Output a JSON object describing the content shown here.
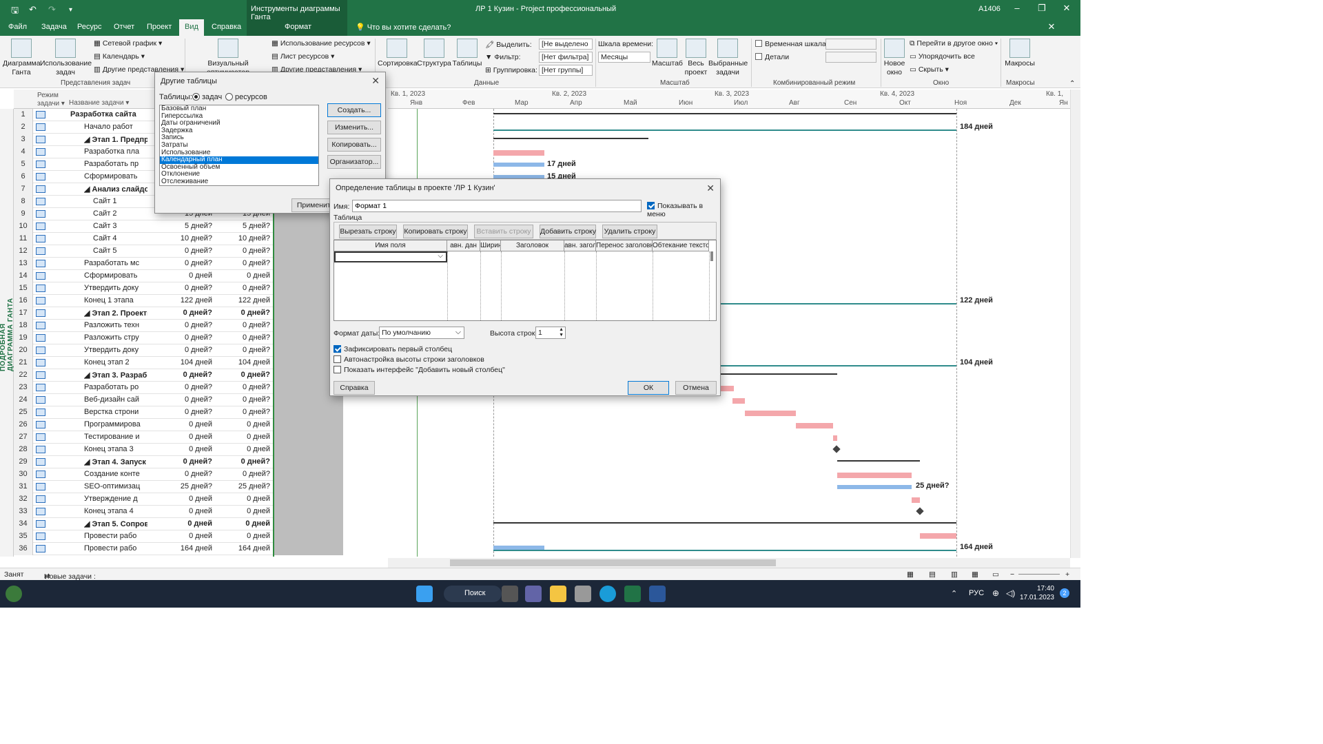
{
  "titlebar": {
    "context_group": "Инструменты диаграммы Ганта",
    "app_title": "ЛР 1 Кузин  -  Project профессиональный",
    "user": "A1406"
  },
  "tabs": [
    "Файл",
    "Задача",
    "Ресурс",
    "Отчет",
    "Проект",
    "Вид",
    "Справка"
  ],
  "active_tab": "Вид",
  "context_tab": "Формат",
  "tell_me": "Что вы хотите сделать?",
  "ribbon": {
    "gantt_chart": "Диаграмма Ганта",
    "task_usage": "Использование задач",
    "network_graph": "Сетевой график",
    "calendar": "Календарь",
    "other_views": "Другие представления",
    "team_planner": "Визуальный оптимизатор",
    "resource_usage": "Использование ресурсов",
    "resource_sheet": "Лист ресурсов",
    "other_views_2": "Другие представления",
    "task_views_group": "Представления задач",
    "sort": "Сортировка",
    "outline": "Структура",
    "tables": "Таблицы",
    "highlight_label": "Выделить:",
    "highlight_value": "[Не выделено",
    "filter_label": "Фильтр:",
    "filter_value": "[Нет фильтра]",
    "group_label": "Группировка:",
    "group_value": "[Нет группы]",
    "data_group": "Данные",
    "timescale_label": "Шкала времени:",
    "timescale_value": "Месяцы",
    "zoom": "Масштаб",
    "entire_project": "Весь проект",
    "selected_tasks": "Выбранные задачи",
    "zoom_group": "Масштаб",
    "timeline_chk": "Временная шкала",
    "details_chk": "Детали",
    "split_group": "Комбинированный режим",
    "new_window": "Новое окно",
    "switch_window": "Перейти в другое окно",
    "arrange_all": "Упорядочить все",
    "hide": "Скрыть",
    "window_group": "Окно",
    "macros": "Макросы",
    "macros_group": "Макросы"
  },
  "grid": {
    "headers": {
      "mode": "Режим задачи",
      "name": "Название задачи",
      "dur": "Д"
    },
    "rows": [
      {
        "n": "1",
        "name": "Разработка сайта",
        "d1": "",
        "d2": "",
        "lvl": 0,
        "bold": true
      },
      {
        "n": "2",
        "name": "Начало работ",
        "d1": "",
        "d2": "",
        "lvl": 1,
        "bold": false
      },
      {
        "n": "3",
        "name": "◢ Этап 1. Предпрое",
        "d1": "",
        "d2": "",
        "lvl": 1,
        "bold": true
      },
      {
        "n": "4",
        "name": "Разработка пла",
        "d1": "",
        "d2": "",
        "lvl": 2,
        "bold": false
      },
      {
        "n": "5",
        "name": "Разработать пр",
        "d1": "",
        "d2": "",
        "lvl": 2,
        "bold": false
      },
      {
        "n": "6",
        "name": "Сформировать",
        "d1": "",
        "d2": "",
        "lvl": 2,
        "bold": false
      },
      {
        "n": "7",
        "name": "◢ Анализ слайдо",
        "d1": "",
        "d2": "",
        "lvl": 2,
        "bold": true
      },
      {
        "n": "8",
        "name": "Сайт 1",
        "d1": "",
        "d2": "",
        "lvl": 3,
        "bold": false
      },
      {
        "n": "9",
        "name": "Сайт 2",
        "d1": "15 дней",
        "d2": "15 дней",
        "lvl": 3,
        "bold": false
      },
      {
        "n": "10",
        "name": "Сайт 3",
        "d1": "5 дней?",
        "d2": "5 дней?",
        "lvl": 3,
        "bold": false
      },
      {
        "n": "11",
        "name": "Сайт 4",
        "d1": "10 дней?",
        "d2": "10 дней?",
        "lvl": 3,
        "bold": false
      },
      {
        "n": "12",
        "name": "Сайт 5",
        "d1": "0 дней?",
        "d2": "0 дней?",
        "lvl": 3,
        "bold": false
      },
      {
        "n": "13",
        "name": "Разработать мс",
        "d1": "0 дней?",
        "d2": "0 дней?",
        "lvl": 2,
        "bold": false
      },
      {
        "n": "14",
        "name": "Сформировать",
        "d1": "0 дней",
        "d2": "0 дней",
        "lvl": 2,
        "bold": false
      },
      {
        "n": "15",
        "name": "Утвердить доку",
        "d1": "0 дней?",
        "d2": "0 дней?",
        "lvl": 2,
        "bold": false
      },
      {
        "n": "16",
        "name": "Конец 1 этапа",
        "d1": "122 дней",
        "d2": "122 дней",
        "lvl": 1,
        "bold": false
      },
      {
        "n": "17",
        "name": "◢ Этап 2. Проектиро",
        "d1": "0 дней?",
        "d2": "0 дней?",
        "lvl": 1,
        "bold": true
      },
      {
        "n": "18",
        "name": "Разложить техн",
        "d1": "0 дней?",
        "d2": "0 дней?",
        "lvl": 2,
        "bold": false
      },
      {
        "n": "19",
        "name": "Разложить стру",
        "d1": "0 дней?",
        "d2": "0 дней?",
        "lvl": 2,
        "bold": false
      },
      {
        "n": "20",
        "name": "Утвердить доку",
        "d1": "0 дней?",
        "d2": "0 дней?",
        "lvl": 2,
        "bold": false
      },
      {
        "n": "21",
        "name": "Конец этап 2",
        "d1": "104 дней",
        "d2": "104 дней",
        "lvl": 1,
        "bold": false
      },
      {
        "n": "22",
        "name": "◢ Этап 3. Разработк",
        "d1": "0 дней?",
        "d2": "0 дней?",
        "lvl": 1,
        "bold": true
      },
      {
        "n": "23",
        "name": "Разработать ро",
        "d1": "0 дней?",
        "d2": "0 дней?",
        "lvl": 2,
        "bold": false
      },
      {
        "n": "24",
        "name": "Веб-дизайн сай",
        "d1": "0 дней?",
        "d2": "0 дней?",
        "lvl": 2,
        "bold": false
      },
      {
        "n": "25",
        "name": "Верстка строни",
        "d1": "0 дней?",
        "d2": "0 дней?",
        "lvl": 2,
        "bold": false
      },
      {
        "n": "26",
        "name": "Программирова",
        "d1": "0 дней",
        "d2": "0 дней",
        "lvl": 2,
        "bold": false
      },
      {
        "n": "27",
        "name": "Тестирование и",
        "d1": "0 дней",
        "d2": "0 дней",
        "lvl": 2,
        "bold": false
      },
      {
        "n": "28",
        "name": "Конец этапа 3",
        "d1": "0 дней",
        "d2": "0 дней",
        "lvl": 1,
        "bold": false
      },
      {
        "n": "29",
        "name": "◢ Этап 4. Запуск сай",
        "d1": "0 дней?",
        "d2": "0 дней?",
        "lvl": 1,
        "bold": true
      },
      {
        "n": "30",
        "name": "Создание конте",
        "d1": "0 дней?",
        "d2": "0 дней?",
        "lvl": 2,
        "bold": false
      },
      {
        "n": "31",
        "name": "SEO-оптимизац",
        "d1": "25 дней?",
        "d2": "25 дней?",
        "lvl": 2,
        "bold": false
      },
      {
        "n": "32",
        "name": "Утверждение д",
        "d1": "0 дней",
        "d2": "0 дней",
        "lvl": 2,
        "bold": false
      },
      {
        "n": "33",
        "name": "Конец этапа 4",
        "d1": "0 дней",
        "d2": "0 дней",
        "lvl": 1,
        "bold": false
      },
      {
        "n": "34",
        "name": "◢ Этап 5. Сопровож",
        "d1": "0 дней",
        "d2": "0 дней",
        "lvl": 1,
        "bold": true
      },
      {
        "n": "35",
        "name": "Провести рабо",
        "d1": "0 дней",
        "d2": "0 дней",
        "lvl": 2,
        "bold": false
      },
      {
        "n": "36",
        "name": "Провести рабо",
        "d1": "164 дней",
        "d2": "164 дней",
        "lvl": 2,
        "bold": false
      }
    ]
  },
  "side_label": "ПОДРОБНАЯ ДИАГРАММА ГАНТА",
  "timescale": {
    "quarters": [
      "Кв. 1, 2023",
      "Кв. 2, 2023",
      "Кв. 3, 2023",
      "Кв. 4, 2023",
      "Кв. 1,"
    ],
    "months": [
      "Янв",
      "Фев",
      "Мар",
      "Апр",
      "Май",
      "Июн",
      "Июл",
      "Авг",
      "Сен",
      "Окт",
      "Ноя",
      "Дек",
      "Ян"
    ]
  },
  "gantt_labels": [
    "184 дней",
    "17 дней",
    "15 дней",
    "122 дней",
    "104 дней",
    "25 дней?",
    "164 дней"
  ],
  "colors": {
    "task_bar": "#f4a7ab",
    "progress_bar": "#8db8e8",
    "baseline": "#2e8b8b",
    "summary": "#333333",
    "brand": "#217346"
  },
  "dialog_tables": {
    "title": "Другие таблицы",
    "tables_label": "Таблицы:",
    "radio_tasks": "задач",
    "radio_resources": "ресурсов",
    "selected_radio": "задач",
    "items": [
      "Базовый план",
      "Гиперссылка",
      "Даты ограничений",
      "Задержка",
      "Запись",
      "Затраты",
      "Использование",
      "Календарный план",
      "Освоенный объем",
      "Отклонение",
      "Отслеживание"
    ],
    "selected_item": "Календарный план",
    "btn_new": "Создать...",
    "btn_edit": "Изменить...",
    "btn_copy": "Копировать...",
    "btn_organizer": "Организатор...",
    "btn_apply": "Применить"
  },
  "dialog_def": {
    "title": "Определение таблицы в проекте 'ЛР 1 Кузин'",
    "name_label": "Имя:",
    "name_value": "Формат 1",
    "show_in_menu": "Показывать в меню",
    "table_label": "Таблица",
    "btn_cut": "Вырезать строку",
    "btn_copy_row": "Копировать строку",
    "btn_paste": "Вставить строку",
    "btn_add": "Добавить строку",
    "btn_delete": "Удалить строку",
    "columns": [
      "Имя поля",
      "авн. дан",
      "Ширин",
      "Заголовок",
      "авн. загол",
      "Перенос заголовк",
      "Обтекание текстом"
    ],
    "date_format_label": "Формат даты:",
    "date_format_value": "По умолчанию",
    "row_height_label": "Высота строк:",
    "row_height_value": "1",
    "lock_first_col": "Зафиксировать первый столбец",
    "auto_header_height": "Автонастройка высоты строки заголовков",
    "show_add_col": "Показать интерфейс \"Добавить новый столбец\"",
    "btn_help": "Справка",
    "btn_ok": "ОК",
    "btn_cancel": "Отмена"
  },
  "statusbar": {
    "status": "Занят",
    "new_tasks": "Новые задачи : Автоматическое планирование"
  },
  "taskbar": {
    "search": "Поиск",
    "lang": "РУС",
    "time": "17:40",
    "date": "17.01.2023",
    "notif_count": "2"
  }
}
